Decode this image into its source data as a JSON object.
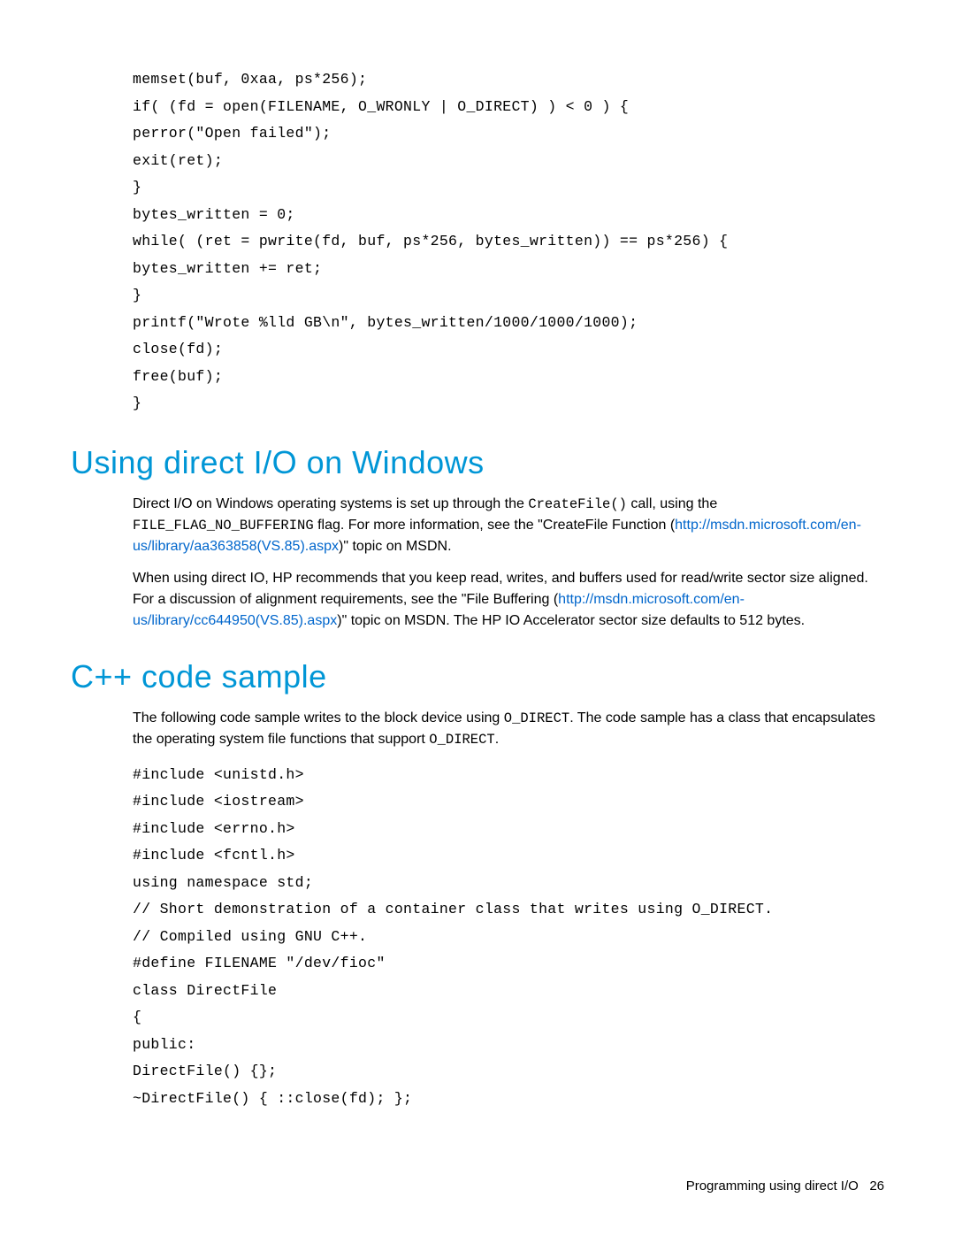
{
  "code_block_1": "memset(buf, 0xaa, ps*256);\nif( (fd = open(FILENAME, O_WRONLY | O_DIRECT) ) < 0 ) {\nperror(\"Open failed\");\nexit(ret);\n}\nbytes_written = 0;\nwhile( (ret = pwrite(fd, buf, ps*256, bytes_written)) == ps*256) {\nbytes_written += ret;\n}\nprintf(\"Wrote %lld GB\\n\", bytes_written/1000/1000/1000);\nclose(fd);\nfree(buf);\n}",
  "heading_windows": "Using direct I/O on Windows",
  "para_windows_1": {
    "pre": "Direct I/O on Windows operating systems is set up through the ",
    "mono1": "CreateFile()",
    "mid1": " call, using the ",
    "mono2": "FILE_FLAG_NO_BUFFERING",
    "mid2": " flag. For more information, see the \"CreateFile Function (",
    "link": "http://msdn.microsoft.com/en-us/library/aa363858(VS.85).aspx",
    "post": ")\" topic on MSDN."
  },
  "para_windows_2": {
    "pre": "When using direct IO, HP recommends that you keep read, writes, and buffers used for read/write sector size aligned. For a discussion of alignment requirements, see the \"File Buffering (",
    "link": "http://msdn.microsoft.com/en-us/library/cc644950(VS.85).aspx",
    "post": ")\" topic on MSDN. The HP IO Accelerator sector size defaults to 512 bytes."
  },
  "heading_cpp": "C++ code sample",
  "para_cpp": {
    "pre": "The following code sample writes to the block device using ",
    "mono1": "O_DIRECT",
    "mid1": ". The code sample has a class that encapsulates the operating system file functions that support ",
    "mono2": "O_DIRECT",
    "post": "."
  },
  "code_block_2": "#include <unistd.h>\n#include <iostream>\n#include <errno.h>\n#include <fcntl.h>\nusing namespace std;\n// Short demonstration of a container class that writes using O_DIRECT.\n// Compiled using GNU C++.\n#define FILENAME \"/dev/fioc\"\nclass DirectFile\n{\npublic:\nDirectFile() {};\n~DirectFile() { ::close(fd); };",
  "footer": {
    "text": "Programming using direct I/O",
    "page": "26"
  }
}
